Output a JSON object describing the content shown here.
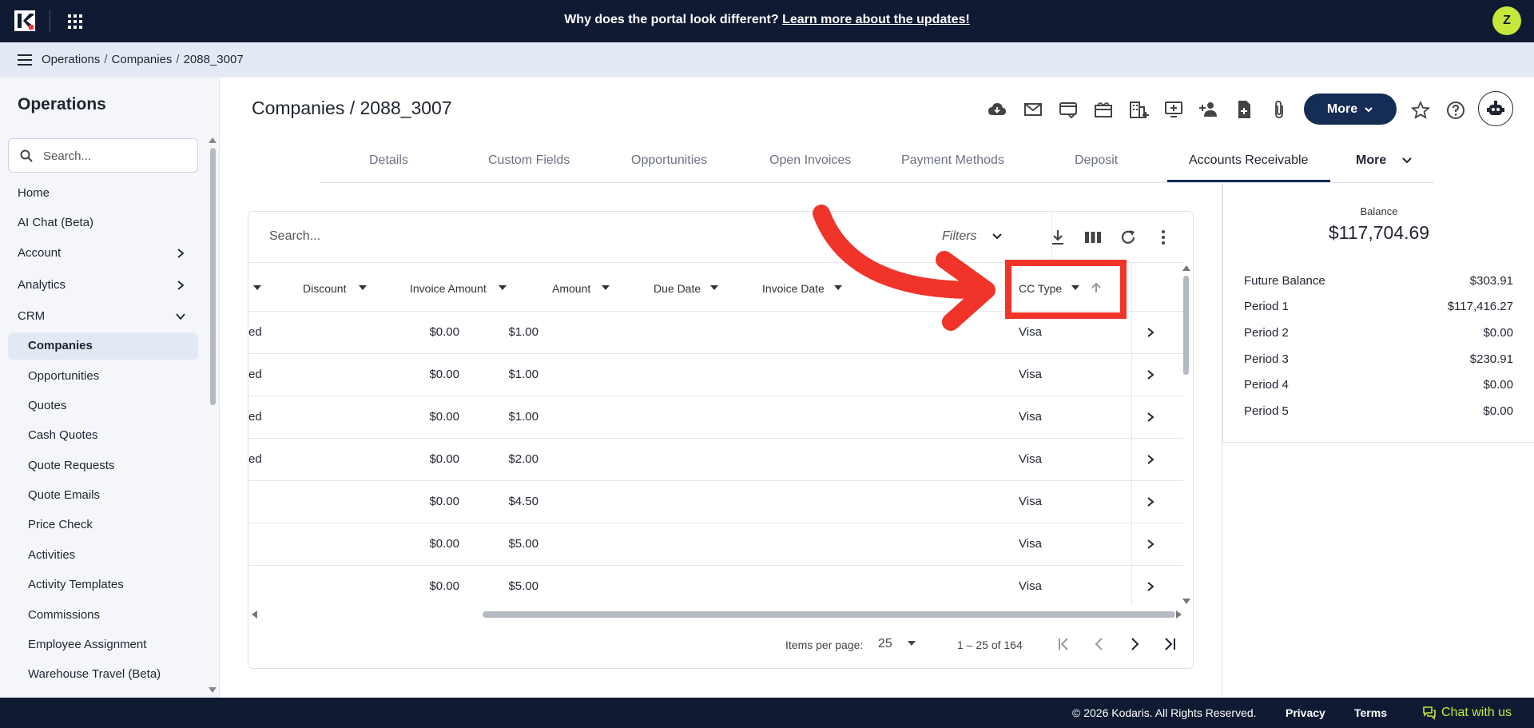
{
  "banner": {
    "text": "Why does the portal look different? ",
    "link": "Learn more about the updates!"
  },
  "user": {
    "initial": "Z",
    "avatar_color": "#c6e73b"
  },
  "breadcrumb": [
    "Operations",
    "Companies",
    "2088_3007"
  ],
  "sidebar": {
    "title": "Operations",
    "search_placeholder": "Search...",
    "items": [
      {
        "label": "Home"
      },
      {
        "label": "AI Chat (Beta)"
      },
      {
        "label": "Account"
      },
      {
        "label": "Analytics"
      },
      {
        "label": "CRM"
      }
    ],
    "crm_items": [
      {
        "label": "Companies"
      },
      {
        "label": "Opportunities"
      },
      {
        "label": "Quotes"
      },
      {
        "label": "Cash Quotes"
      },
      {
        "label": "Quote Requests"
      },
      {
        "label": "Quote Emails"
      },
      {
        "label": "Price Check"
      },
      {
        "label": "Activities"
      },
      {
        "label": "Activity Templates"
      },
      {
        "label": "Commissions"
      },
      {
        "label": "Employee Assignment"
      },
      {
        "label": "Warehouse Travel (Beta)"
      }
    ]
  },
  "page": {
    "title": "Companies / 2088_3007",
    "more_label": "More",
    "accent": "#152c55"
  },
  "tabs": [
    {
      "label": "Details"
    },
    {
      "label": "Custom Fields"
    },
    {
      "label": "Opportunities"
    },
    {
      "label": "Open Invoices"
    },
    {
      "label": "Payment Methods"
    },
    {
      "label": "Deposit"
    },
    {
      "label": "Accounts Receivable"
    }
  ],
  "tabs_more": "More",
  "table": {
    "search_placeholder": "Search...",
    "filters_label": "Filters",
    "columns": [
      {
        "label": "Discount"
      },
      {
        "label": "Invoice Amount"
      },
      {
        "label": "Amount"
      },
      {
        "label": "Due Date"
      },
      {
        "label": "Invoice Date"
      },
      {
        "label": "CC Type"
      }
    ],
    "rows": [
      {
        "status": "ed",
        "invoice_amount": "$0.00",
        "amount": "$1.00",
        "cc_type": "Visa"
      },
      {
        "status": "ed",
        "invoice_amount": "$0.00",
        "amount": "$1.00",
        "cc_type": "Visa"
      },
      {
        "status": "ed",
        "invoice_amount": "$0.00",
        "amount": "$1.00",
        "cc_type": "Visa"
      },
      {
        "status": "ed",
        "invoice_amount": "$0.00",
        "amount": "$2.00",
        "cc_type": "Visa"
      },
      {
        "status": "",
        "invoice_amount": "$0.00",
        "amount": "$4.50",
        "cc_type": "Visa"
      },
      {
        "status": "",
        "invoice_amount": "$0.00",
        "amount": "$5.00",
        "cc_type": "Visa"
      },
      {
        "status": "",
        "invoice_amount": "$0.00",
        "amount": "$5.00",
        "cc_type": "Visa"
      }
    ],
    "pager": {
      "items_per_page_label": "Items per page:",
      "page_size": "25",
      "range": "1 – 25 of 164"
    }
  },
  "balance": {
    "label": "Balance",
    "value": "$117,704.69",
    "rows": [
      {
        "label": "Future Balance",
        "value": "$303.91"
      },
      {
        "label": "Period 1",
        "value": "$117,416.27"
      },
      {
        "label": "Period 2",
        "value": "$0.00"
      },
      {
        "label": "Period 3",
        "value": "$230.91"
      },
      {
        "label": "Period 4",
        "value": "$0.00"
      },
      {
        "label": "Period 5",
        "value": "$0.00"
      }
    ]
  },
  "footer": {
    "copyright": "© 2026 Kodaris. All Rights Reserved.",
    "privacy": "Privacy",
    "terms": "Terms",
    "chat": "Chat with us"
  },
  "annotation_color": "#f0342a"
}
